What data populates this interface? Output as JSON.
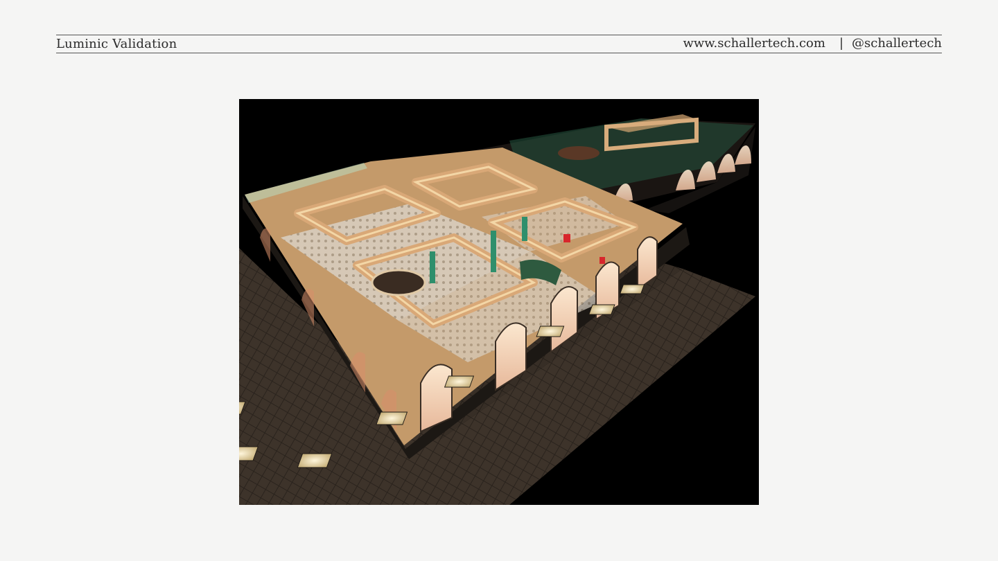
{
  "header": {
    "title": "Luminic Validation",
    "website": "www.schallertech.com",
    "separator": "|",
    "handle": "@schallertech"
  },
  "image": {
    "subject": "restaurant-render",
    "colors": {
      "background": "#000000",
      "ground": "#3a3128",
      "floor": "#c49a6a",
      "wall": "#1c1814",
      "glow": "#f3d6a6",
      "accent_green": "#2f8f6c",
      "accent_red": "#d8262b"
    }
  }
}
